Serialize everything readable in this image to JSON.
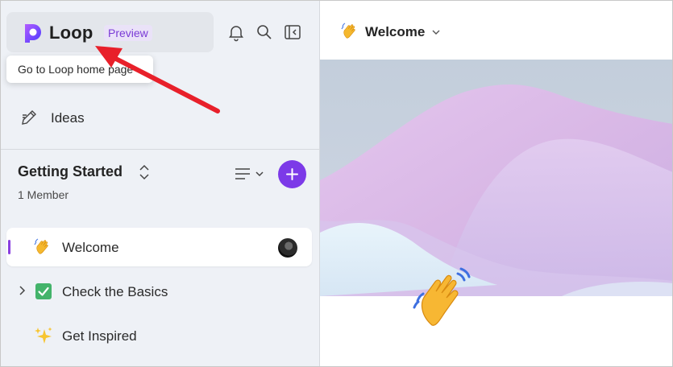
{
  "app": {
    "brand": "Loop",
    "badge": "Preview",
    "accent": "#7c3ae8"
  },
  "header_icons": [
    "bell-icon",
    "search-icon",
    "collapse-sidebar-icon"
  ],
  "tooltip": {
    "text": "Go to Loop home page"
  },
  "nav": {
    "ideas_label": "Ideas"
  },
  "workspace": {
    "title": "Getting Started",
    "members": "1 Member"
  },
  "pages": [
    {
      "label": "Welcome",
      "emoji": "waving-hand",
      "active": true
    },
    {
      "label": "Check the Basics",
      "emoji": "check-mark-box",
      "active": false
    },
    {
      "label": "Get Inspired",
      "emoji": "sparkles",
      "active": false
    }
  ],
  "main": {
    "page_title": "Welcome",
    "page_emoji": "waving-hand"
  },
  "annotation": {
    "arrow_color": "#e8202a"
  }
}
